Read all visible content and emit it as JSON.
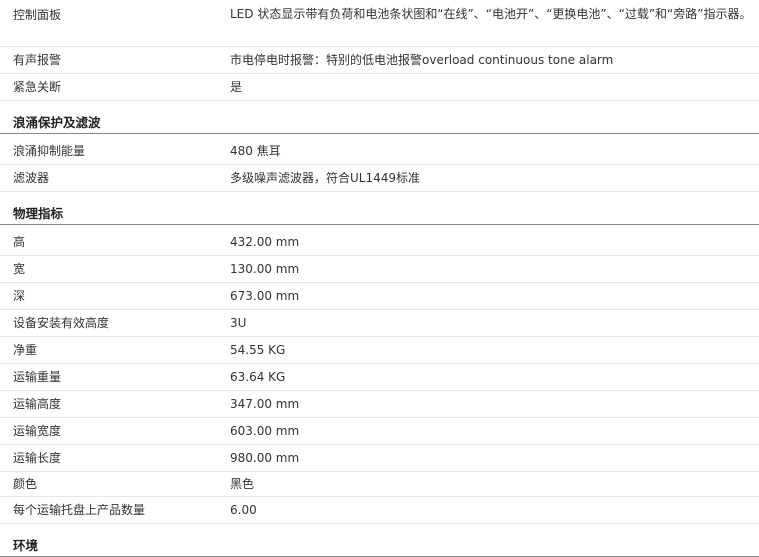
{
  "rows_top": [
    {
      "label": "控制面板",
      "value": "LED 状态显示带有负荷和电池条状图和“在线”、“电池开”、“更换电池”、“过载”和“旁路”指示器。"
    },
    {
      "label": "有声报警",
      "value": "市电停电时报警：特别的低电池报警overload continuous tone alarm"
    },
    {
      "label": "紧急关断",
      "value": "是"
    }
  ],
  "section_surge": {
    "title": "浪涌保护及滤波",
    "rows": [
      {
        "label": "浪涌抑制能量",
        "value": "480 焦耳"
      },
      {
        "label": "滤波器",
        "value": "多级噪声滤波器，符合UL1449标准"
      }
    ]
  },
  "section_physical": {
    "title": "物理指标",
    "rows": [
      {
        "label": "高",
        "value": "432.00 mm"
      },
      {
        "label": "宽",
        "value": "130.00 mm"
      },
      {
        "label": "深",
        "value": "673.00 mm"
      },
      {
        "label": "设备安装有效高度",
        "value": "3U"
      },
      {
        "label": "净重",
        "value": "54.55 KG"
      },
      {
        "label": "运输重量",
        "value": "63.64 KG"
      },
      {
        "label": "运输高度",
        "value": "347.00 mm"
      },
      {
        "label": "运输宽度",
        "value": "603.00 mm"
      },
      {
        "label": "运输长度",
        "value": "980.00 mm"
      },
      {
        "label": "颜色",
        "value": "黑色"
      },
      {
        "label": "每个运输托盘上产品数量",
        "value": "6.00"
      }
    ]
  },
  "section_env": {
    "title": "环境"
  }
}
